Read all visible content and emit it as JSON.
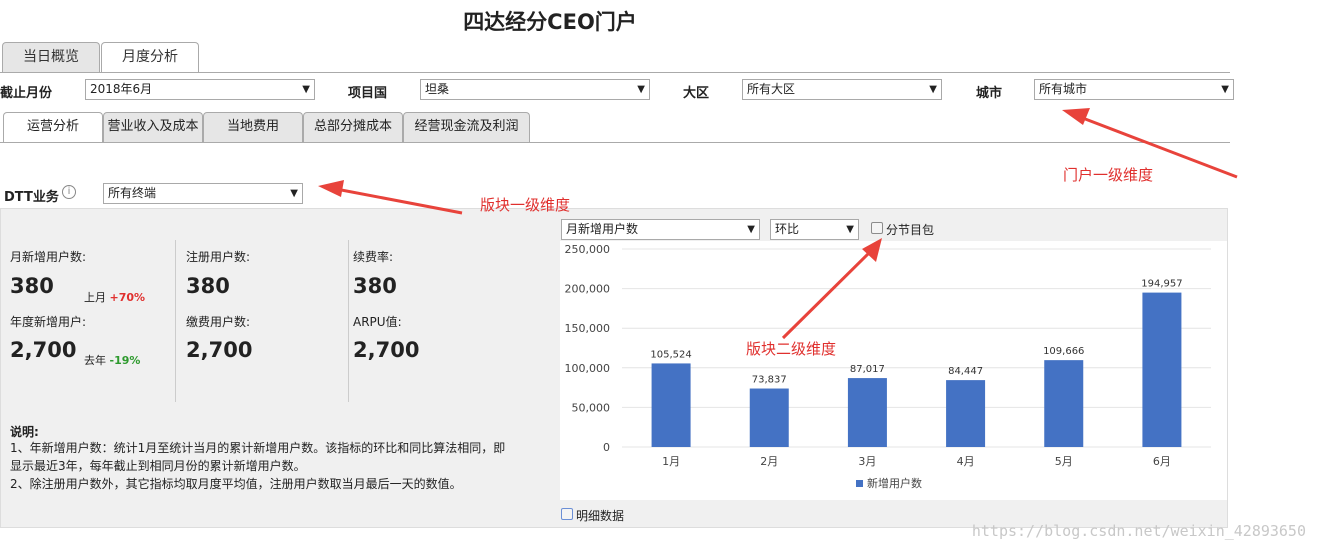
{
  "page": {
    "title": "四达经分CEO门户"
  },
  "main_tabs": [
    {
      "label": "当日概览",
      "active": false
    },
    {
      "label": "月度分析",
      "active": true
    }
  ],
  "filters": {
    "month": {
      "label": "截止月份",
      "value": "2018年6月"
    },
    "country": {
      "label": "项目国",
      "value": "坦桑"
    },
    "region": {
      "label": "大区",
      "value": "所有大区"
    },
    "city": {
      "label": "城市",
      "value": "所有城市"
    }
  },
  "sub_tabs": [
    {
      "label": "运营分析",
      "active": true
    },
    {
      "label": "营业收入及成本",
      "active": false
    },
    {
      "label": "当地费用",
      "active": false
    },
    {
      "label": "总部分摊成本",
      "active": false
    },
    {
      "label": "经营现金流及利润",
      "active": false
    }
  ],
  "business": {
    "label": "DTT业务",
    "info_icon": "info-icon",
    "value": "所有终端"
  },
  "metrics": {
    "monthly_new": {
      "label": "月新增用户数:",
      "value": "380",
      "cmp_label": "上月",
      "cmp_value": "+70%",
      "cmp_color": "#e0302e"
    },
    "yearly_new": {
      "label": "年度新增用户:",
      "value": "2,700",
      "cmp_label": "去年",
      "cmp_value": "-19%",
      "cmp_color": "#2e9a2e"
    },
    "registered": {
      "label": "注册用户数:",
      "value": "380"
    },
    "paying": {
      "label": "缴费用户数:",
      "value": "2,700"
    },
    "renewal": {
      "label": "续费率:",
      "value": "380"
    },
    "arpu": {
      "label": "ARPU值:",
      "value": "2,700"
    }
  },
  "notes": {
    "heading": "说明:",
    "line1": "1、年新增用户数：统计1月至统计当月的累计新增用户数。该指标的环比和同比算法相同，即",
    "line2": "显示最近3年，每年截止到相同月份的累计新增用户数。",
    "line3": "2、除注册用户数外，其它指标均取月度平均值，注册用户数取当月最后一天的数值。"
  },
  "chart_controls": {
    "metric": "月新增用户数",
    "compare": "环比",
    "checkbox_label": "分节目包"
  },
  "detail_checkbox_label": "明细数据",
  "annotations": {
    "portal_dim": "门户一级维度",
    "block_dim1": "版块一级维度",
    "block_dim2": "版块二级维度"
  },
  "watermark": "https://blog.csdn.net/weixin_42893650",
  "chart_data": {
    "type": "bar",
    "categories": [
      "1月",
      "2月",
      "3月",
      "4月",
      "5月",
      "6月"
    ],
    "series": [
      {
        "name": "新增用户数",
        "values": [
          105524,
          73837,
          87017,
          84447,
          109666,
          194957
        ],
        "color": "#4472c4"
      }
    ],
    "ylim": [
      0,
      250000
    ],
    "yticks": [
      0,
      50000,
      100000,
      150000,
      200000,
      250000
    ],
    "ytick_labels": [
      "0",
      "50,000",
      "100,000",
      "150,000",
      "200,000",
      "250,000"
    ],
    "data_labels": [
      "105,524",
      "73,837",
      "87,017",
      "84,447",
      "109,666",
      "194,957"
    ],
    "legend": "bottom",
    "grid": true
  }
}
